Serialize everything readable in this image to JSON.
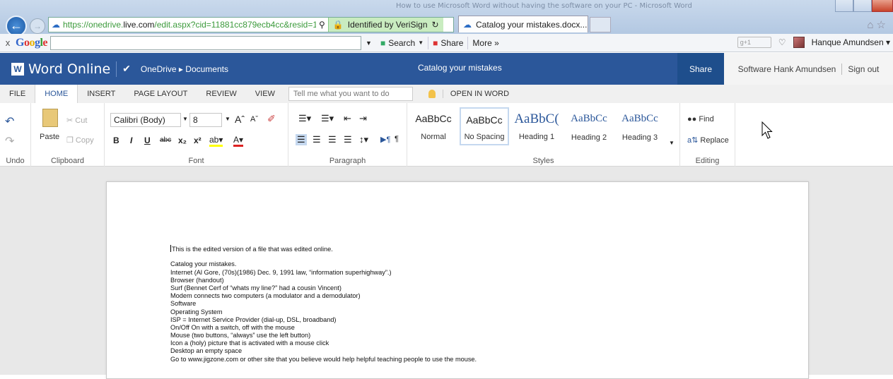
{
  "browser": {
    "title_text": "How to use Microsoft Word without having the software on your PC - Microsoft Word",
    "address": {
      "url_prefix": "https://onedrive.",
      "url_domain": "live.com",
      "url_rest": "/edit.aspx?cid=11881cc879ecb4cc&resid=11881(",
      "verified": "Identified by VeriSign"
    },
    "tab_label": "Catalog your mistakes.docx..."
  },
  "google_toolbar": {
    "close": "x",
    "logo": "Google",
    "search_label": "Search",
    "share_label": "Share",
    "more_label": "More »",
    "gplus": "g+1",
    "user": "Hanque Amundsen"
  },
  "word": {
    "logo": "W",
    "app_name": "Word Online",
    "breadcrumb": "OneDrive ▸ Documents",
    "doc_title": "Catalog your mistakes",
    "share": "Share",
    "user_name": "Software Hank Amundsen",
    "sign_out": "Sign out"
  },
  "ribbon_tabs": {
    "file": "FILE",
    "home": "HOME",
    "insert": "INSERT",
    "page_layout": "PAGE LAYOUT",
    "review": "REVIEW",
    "view": "VIEW",
    "tell_me": "Tell me what you want to do",
    "open_in_word": "OPEN IN WORD"
  },
  "ribbon": {
    "undo_label": "Undo",
    "clipboard": {
      "paste": "Paste",
      "cut": "Cut",
      "copy": "Copy",
      "label": "Clipboard"
    },
    "font": {
      "name": "Calibri (Body)",
      "size": "8",
      "label": "Font"
    },
    "paragraph": {
      "label": "Paragraph"
    },
    "styles": {
      "label": "Styles",
      "items": [
        {
          "sample": "AaBbCc",
          "name": "Normal"
        },
        {
          "sample": "AaBbCc",
          "name": "No Spacing"
        },
        {
          "sample": "AaBbC(",
          "name": "Heading 1"
        },
        {
          "sample": "AaBbCc",
          "name": "Heading 2"
        },
        {
          "sample": "AaBbCc",
          "name": "Heading 3"
        }
      ]
    },
    "editing": {
      "find": "Find",
      "replace": "Replace",
      "label": "Editing"
    }
  },
  "document": {
    "first_line": "This is the edited version of a file that was edited online.",
    "lines": [
      "Catalog your mistakes.",
      "Internet  (Al Gore, (70s)(1986) Dec. 9, 1991 law, “information superhighway”.)",
      "Browser (handout)",
      "Surf  (Bennet Cerf  of  “whats my line?” had a cousin Vincent)",
      "Modem connects two computers (a modulator and a demodulator)",
      "Software",
      "Operating System",
      "ISP = Internet Service Provider (dial-up, DSL, broadband)",
      "On/Off   On with a switch, off with the mouse",
      "Mouse  (two buttons, “always” use the left button)",
      "Icon a (holy) picture that is activated with a mouse click",
      "Desktop  an empty space",
      "Go to www.jigzone.com  or other site that you believe would help helpful teaching people to use the mouse."
    ]
  }
}
